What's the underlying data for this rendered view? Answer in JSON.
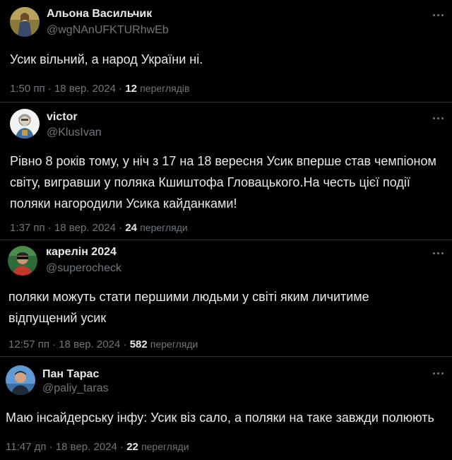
{
  "tweets": [
    {
      "name": "Альона Васильчик",
      "handle": "@wgNAnUFKTURhwEb",
      "text": "Усик вільний, а народ України ні.",
      "time": "1:50 пп",
      "date": "18 вер. 2024",
      "views": "12",
      "views_label": "перегля­дів"
    },
    {
      "name": "victor",
      "handle": "@KlusIvan",
      "text": "Рівно 8 років тому, у ніч з 17 на 18 вересня Усик вперше став чемпіоном\nсвіту, виграв­ши у поляка Кшиштофа Гловацького.На честь цієї події\nполяки нагородили Усика кайданками!",
      "time": "1:37 пп",
      "date": "18 вер. 2024",
      "views": "24",
      "views_label": "перегляди"
    },
    {
      "name": "карелін 2024",
      "handle": "@superocheck",
      "text": "поляки можуть стати першими людьми у світі яким личитиме\nвідпущений усик",
      "time": "12:57 пп",
      "date": "18 вер. 2024",
      "views": "582",
      "views_label": "перегляди"
    },
    {
      "name": "Пан Тарас",
      "handle": "@paliy_taras",
      "text": "Маю інсайдерську інфу: Усик віз сало, а поляки на таке завжди полюють",
      "time": "11:47 дп",
      "date": "18 вер. 2024",
      "views": "22",
      "views_label": "перегляди"
    }
  ],
  "separator": "·",
  "colors": {
    "background": "#000000",
    "text": "#e7e9ea",
    "secondary": "#71767b",
    "divider": "#2f3336"
  },
  "icons": {
    "more": "more-horizontal-icon"
  }
}
